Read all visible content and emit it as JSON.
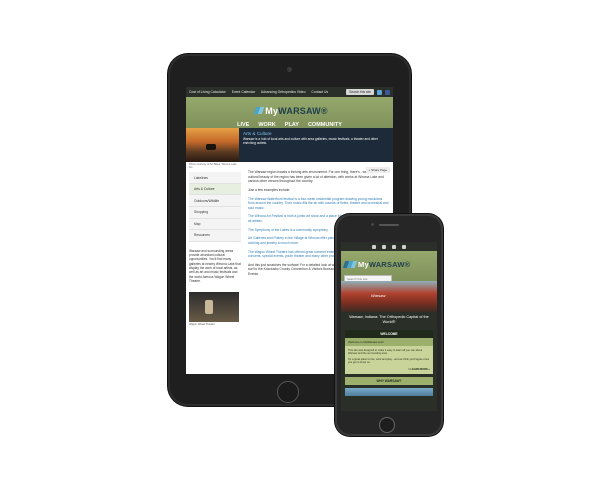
{
  "tablet": {
    "topnav": [
      "Cost of Living Calculator",
      "Event Calendar",
      "Advancing Orthopedics Video",
      "Contact Us"
    ],
    "search_placeholder": "Search this site",
    "logo_prefix": "My",
    "logo_name": "WARSAW",
    "logo_trademark": "®",
    "mainnav": [
      "LIVE",
      "WORK",
      "PLAY",
      "COMMUNITY"
    ],
    "banner_title": "Arts & Culture",
    "banner_desc": "Warsaw is a hub of local arts and culture with area galleries, music festivals, a theater and other enriching outlets.",
    "banner_caption": "Photo courtesy of Art Bikes, Winona Lake Inc.",
    "share": "+ Share Page",
    "sidenav": [
      "Lakelines",
      "Arts & Culture",
      "Outdoors/Wildlife",
      "Shopping",
      "Map",
      "Resources"
    ],
    "side_text": "Warsaw and surrounding areas provide abundant cultural opportunities. You'll find many galleries at nearby Winona Lake that display the work of local artists, as well as art and music festivals and the world-famous Wagon Wheel Theatre.",
    "side_caption": "Wagon Wheel Theatre",
    "paragraphs": [
      "The Warsaw region boasts a thriving arts environment. For one thing, there's - well, art! The cultural beauty of the region has been given a lot of attention, with works at Winona Lake and various other venues throughout the country.",
      "Just a few examples include:",
      "The Warsaw Waterfront festival is a four-week residential program drawing young musicians from around the country. Their music fills the air with sounds of flutes, theatre and orchestral and solo music.",
      "The Winona Art Festival is both a juried art show and a place for art lovers alike for an array of all artistic.",
      "The Symphony of the Lakes is a community symphony.",
      "Art Galleries and Pottery in the Village at Winona offer paintings, pottery and everything from clothing and jewelry to much more.",
      "The Wagon Wheel Theatre has offered great summer entertainment for 55 years. It also hosts concerts, special events, youth theater and many other programs.",
      "And this just scratches the surface! For a detailed look at what's happening in Kosciusko County, surf to the Kosciusko County Convention & Visitors Bureau and check out our Calendar of Events."
    ]
  },
  "phone": {
    "logo_prefix": "My",
    "logo_name": "WARSAW",
    "logo_trademark": "®",
    "search_placeholder": "Search this site",
    "hero_tagline": "Warsaw",
    "caption": "Warsaw, Indiana: The Orthopedic Capital of the World®",
    "welcome_title": "WELCOME",
    "welcome_sub": "Welcome to MyWarsaw.com!",
    "welcome_body_1": "This site was designed to make it easy to learn all you can about Warsaw and the surrounding area.",
    "welcome_body_2": "It's a great place to live, work and play - and we think you'll agree once you get to know us.",
    "learn_more": "> LEARN MORE »",
    "why_title": "WHY WARSAW?"
  },
  "colors": {
    "header_green": "#8ea166",
    "link_blue": "#2e7fb5",
    "device_dark": "#1f1f1f"
  },
  "icons": [
    "youtube-icon",
    "twitter-icon",
    "facebook-icon",
    "search-icon"
  ]
}
